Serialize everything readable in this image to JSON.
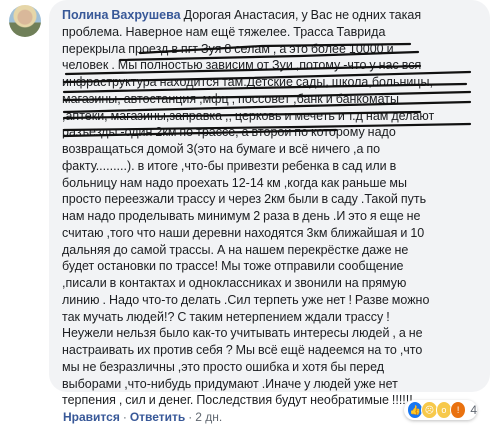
{
  "comment": {
    "author": "Полина Вахрушева",
    "lines": [
      "Дорогая Анастасия, у Вас не одних такая",
      "проблема. Наверное нам ещё тяжелее. Трасса Таврида",
      "перекрыла проезд в пгт Зуя 8 селам , а это более 10000 и",
      "человек . Мы полностью зависим от Зуи ,потому -что у нас вся",
      "инфраструктура находится там.Детские сады, школа,больницы,",
      "магазины, автостанция ,мфц , поссовет ,банк и банкоматы",
      ",аптеки, магазины,заправка ,, церковь и мечеть и т.д нам делают",
      "разъезды -один 2км по трассе, а второй по которому надо",
      "возвращаться домой 3(это на бумаге и всё ничего ,а по",
      "факту.........). в итоге ,что-бы привезти ребенка в сад или в",
      "больницу нам надо проехать 12-14 км ,когда как раньше мы",
      "просто переезжали трассу и через 2км были в саду .Такой путь",
      "нам надо проделывать минимум 2 раза в день .И это я еще не",
      "считаю ,того что наши деревни находятся 3км ближайшая и 10",
      "дальняя до самой трассы. А на нашем перекрёстке даже не",
      "будет остановки по трассе! Мы тоже отправили сообщение",
      ",писали в контактах и одноклассниках и звонили на прямую",
      "линию . Надо что-то делать .Сил терпеть уже нет ! Разве можно",
      "так мучать людей!? С таким нетерпением ждали трассу !",
      "Неужели нельзя было как-то учитывать интересы людей , а не",
      "настраивать их против себя ? Мы всё ещё надеемся на то ,что",
      "мы не безразличны ,это просто ошибка и хотя бы перед",
      "выборами ,что-нибудь придумают .Иначе у людей уже нет",
      "терпения , сил и денег. Последствия будут необратимые !!!!!!"
    ]
  },
  "reactions": {
    "count": "4",
    "icons": [
      "like-icon",
      "sad-icon",
      "wow-icon",
      "angry-icon"
    ]
  },
  "actions": {
    "like": "Нравится",
    "reply": "Ответить",
    "separator": "·",
    "time": "2 дн."
  },
  "colors": {
    "author": "#385898",
    "bubble": "#f2f3f5",
    "scribble": "#111111"
  }
}
